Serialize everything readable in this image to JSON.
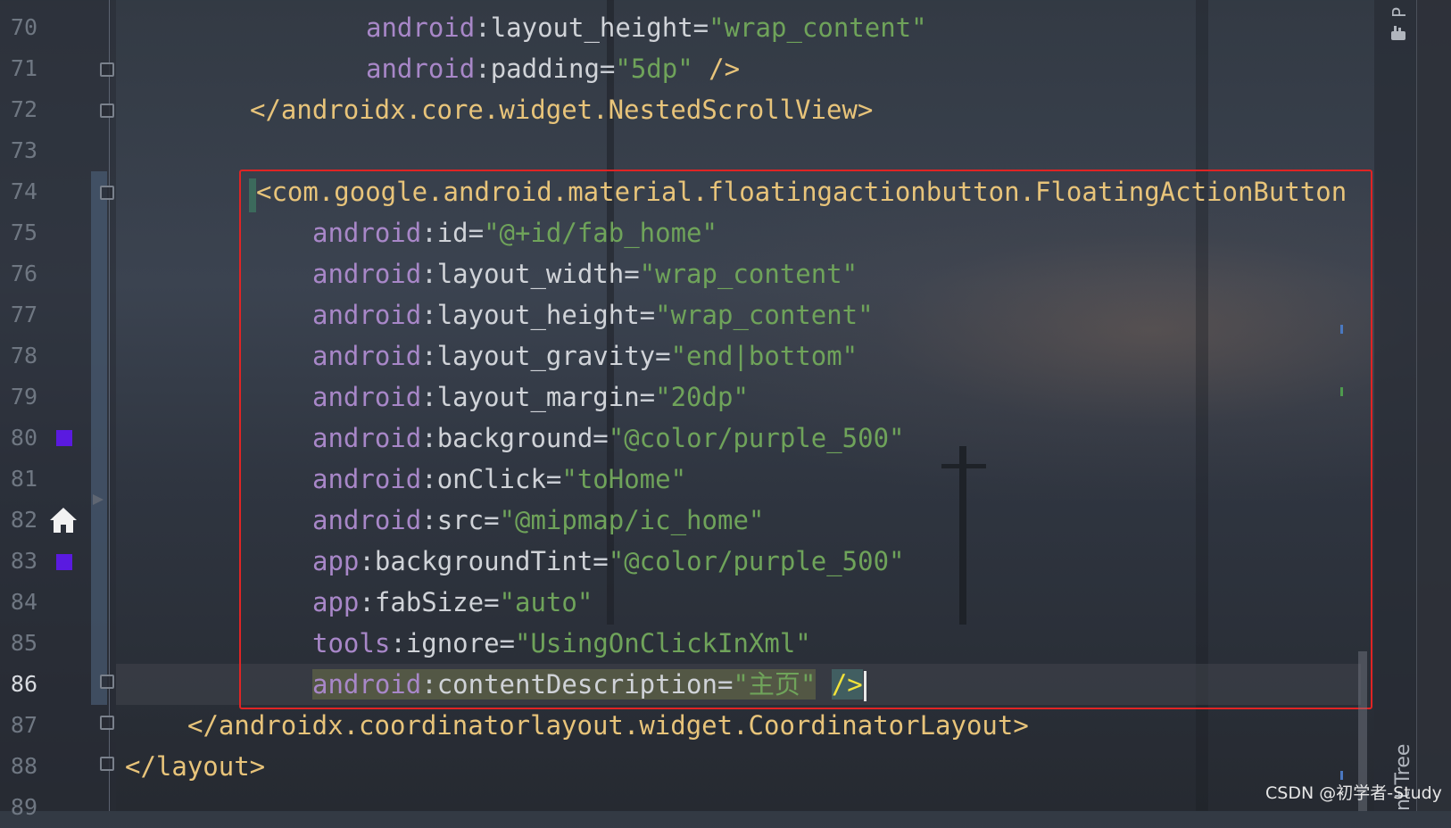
{
  "editor": {
    "lines": [
      {
        "num": "70",
        "parts": [
          {
            "t": "ns",
            "v": "android"
          },
          {
            "t": "eq",
            "v": ":"
          },
          {
            "t": "attr",
            "v": "layout_height"
          },
          {
            "t": "eq",
            "v": "="
          },
          {
            "t": "val",
            "v": "\"wrap_content\""
          }
        ]
      },
      {
        "num": "71",
        "parts": [
          {
            "t": "ns",
            "v": "android"
          },
          {
            "t": "eq",
            "v": ":"
          },
          {
            "t": "attr",
            "v": "padding"
          },
          {
            "t": "eq",
            "v": "="
          },
          {
            "t": "val",
            "v": "\"5dp\""
          },
          {
            "t": "brk",
            "v": " />"
          }
        ]
      },
      {
        "num": "72",
        "parts": [
          {
            "t": "tag",
            "v": "</androidx.core.widget.NestedScrollView>"
          }
        ]
      },
      {
        "num": "73",
        "parts": []
      },
      {
        "num": "74",
        "parts": [
          {
            "t": "brk",
            "v": "<"
          },
          {
            "t": "tag",
            "v": "com.google.android.material.floatingactionbutton.FloatingActionButton"
          }
        ]
      },
      {
        "num": "75",
        "parts": [
          {
            "t": "ns",
            "v": "android"
          },
          {
            "t": "eq",
            "v": ":"
          },
          {
            "t": "attr",
            "v": "id"
          },
          {
            "t": "eq",
            "v": "="
          },
          {
            "t": "val",
            "v": "\"@+id/fab_home\""
          }
        ]
      },
      {
        "num": "76",
        "parts": [
          {
            "t": "ns",
            "v": "android"
          },
          {
            "t": "eq",
            "v": ":"
          },
          {
            "t": "attr",
            "v": "layout_width"
          },
          {
            "t": "eq",
            "v": "="
          },
          {
            "t": "val",
            "v": "\"wrap_content\""
          }
        ]
      },
      {
        "num": "77",
        "parts": [
          {
            "t": "ns",
            "v": "android"
          },
          {
            "t": "eq",
            "v": ":"
          },
          {
            "t": "attr",
            "v": "layout_height"
          },
          {
            "t": "eq",
            "v": "="
          },
          {
            "t": "val",
            "v": "\"wrap_content\""
          }
        ]
      },
      {
        "num": "78",
        "parts": [
          {
            "t": "ns",
            "v": "android"
          },
          {
            "t": "eq",
            "v": ":"
          },
          {
            "t": "attr",
            "v": "layout_gravity"
          },
          {
            "t": "eq",
            "v": "="
          },
          {
            "t": "val",
            "v": "\"end|bottom\""
          }
        ]
      },
      {
        "num": "79",
        "parts": [
          {
            "t": "ns",
            "v": "android"
          },
          {
            "t": "eq",
            "v": ":"
          },
          {
            "t": "attr",
            "v": "layout_margin"
          },
          {
            "t": "eq",
            "v": "="
          },
          {
            "t": "val",
            "v": "\"20dp\""
          }
        ]
      },
      {
        "num": "80",
        "parts": [
          {
            "t": "ns",
            "v": "android"
          },
          {
            "t": "eq",
            "v": ":"
          },
          {
            "t": "attr",
            "v": "background"
          },
          {
            "t": "eq",
            "v": "="
          },
          {
            "t": "val",
            "v": "\"@color/purple_500\""
          }
        ]
      },
      {
        "num": "81",
        "parts": [
          {
            "t": "ns",
            "v": "android"
          },
          {
            "t": "eq",
            "v": ":"
          },
          {
            "t": "attr",
            "v": "onClick"
          },
          {
            "t": "eq",
            "v": "="
          },
          {
            "t": "val",
            "v": "\"toHome\""
          }
        ]
      },
      {
        "num": "82",
        "parts": [
          {
            "t": "ns",
            "v": "android"
          },
          {
            "t": "eq",
            "v": ":"
          },
          {
            "t": "attr",
            "v": "src"
          },
          {
            "t": "eq",
            "v": "="
          },
          {
            "t": "val",
            "v": "\"@mipmap/ic_home\""
          }
        ]
      },
      {
        "num": "83",
        "parts": [
          {
            "t": "ns",
            "v": "app"
          },
          {
            "t": "eq",
            "v": ":"
          },
          {
            "t": "attr",
            "v": "backgroundTint"
          },
          {
            "t": "eq",
            "v": "="
          },
          {
            "t": "val",
            "v": "\"@color/purple_500\""
          }
        ]
      },
      {
        "num": "84",
        "parts": [
          {
            "t": "ns",
            "v": "app"
          },
          {
            "t": "eq",
            "v": ":"
          },
          {
            "t": "attr",
            "v": "fabSize"
          },
          {
            "t": "eq",
            "v": "="
          },
          {
            "t": "val",
            "v": "\"auto\""
          }
        ]
      },
      {
        "num": "85",
        "parts": [
          {
            "t": "ns",
            "v": "tools"
          },
          {
            "t": "eq",
            "v": ":"
          },
          {
            "t": "attr",
            "v": "ignore"
          },
          {
            "t": "eq",
            "v": "="
          },
          {
            "t": "val",
            "v": "\"UsingOnClickInXml\""
          }
        ]
      },
      {
        "num": "86",
        "parts": [
          {
            "t": "ns",
            "v": "android",
            "hl": "attr"
          },
          {
            "t": "eq",
            "v": ":",
            "hl": "attr"
          },
          {
            "t": "attr",
            "v": "contentDescription",
            "hl": "attr"
          },
          {
            "t": "eq",
            "v": "=",
            "hl": "attr"
          },
          {
            "t": "val",
            "v": "\"主页\"",
            "hl": "attr"
          },
          {
            "t": "eq",
            "v": " "
          },
          {
            "t": "brk",
            "v": "/>",
            "hl": "close"
          }
        ]
      },
      {
        "num": "87",
        "parts": [
          {
            "t": "tag",
            "v": "</androidx.coordinatorlayout.widget.CoordinatorLayout>"
          }
        ]
      },
      {
        "num": "88",
        "parts": [
          {
            "t": "tag",
            "v": "</layout>"
          }
        ]
      },
      {
        "num": "89",
        "parts": []
      }
    ],
    "current_line": "86",
    "swatch_color": "#5a1ae0",
    "gutter_icons": {
      "home": "home-icon"
    }
  },
  "sidebar": {
    "bottom_label": "nt Tree",
    "top_label": "P"
  },
  "watermark": "CSDN @初学者-Study"
}
